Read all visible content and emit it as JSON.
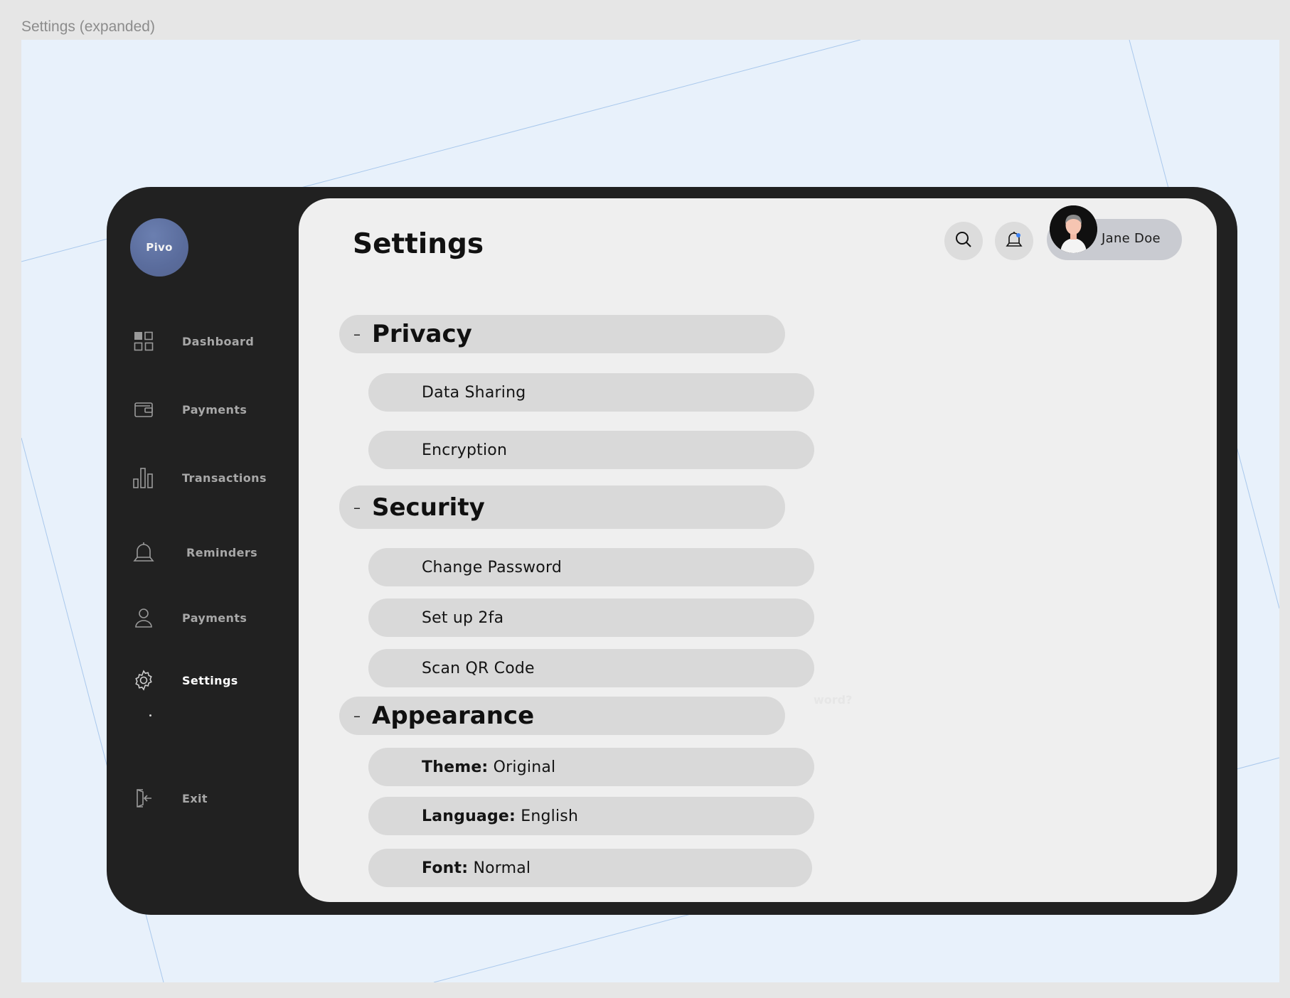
{
  "frame": {
    "label": "Settings (expanded)"
  },
  "brand": {
    "logo_text": "Pivo"
  },
  "sidebar": {
    "items": [
      {
        "label": "Dashboard",
        "icon": "grid-icon"
      },
      {
        "label": "Payments",
        "icon": "wallet-icon"
      },
      {
        "label": "Transactions",
        "icon": "bar-chart-icon"
      },
      {
        "label": "Reminders",
        "icon": "bell-icon"
      },
      {
        "label": "Payments",
        "icon": "user-icon"
      },
      {
        "label": "Settings",
        "icon": "gear-icon",
        "active": true
      }
    ],
    "exit_label": "Exit"
  },
  "header": {
    "title": "Settings",
    "user_name": "Jane Doe"
  },
  "sections": {
    "privacy": {
      "toggle": "–",
      "title": "Privacy",
      "options": [
        "Data Sharing",
        "Encryption"
      ]
    },
    "security": {
      "toggle": "–",
      "title": "Security",
      "options": [
        "Change Password",
        "Set up 2fa",
        "Scan QR Code"
      ]
    },
    "appearance": {
      "toggle": "–",
      "title": "Appearance",
      "options": [
        {
          "key": "Theme:",
          "value": "Original"
        },
        {
          "key": "Language:",
          "value": "English"
        },
        {
          "key": "Font:",
          "value": "Normal"
        }
      ]
    }
  },
  "ghost_text": "word?",
  "colors": {
    "device": "#212121",
    "panel": "#efefef",
    "pill": "#d9d9d9",
    "logo": "#5f72a3",
    "notification_dot": "#3b82f6",
    "canvas": "#e8f1fb"
  }
}
